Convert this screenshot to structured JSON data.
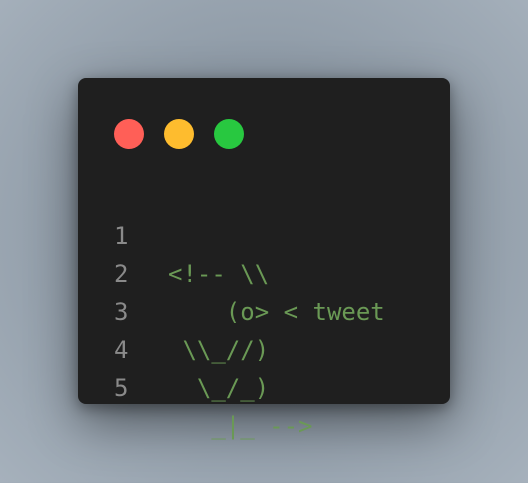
{
  "colors": {
    "red": "#ff5f57",
    "yellow": "#febc2e",
    "green": "#28c840",
    "line_number": "#8a8a8a",
    "code": "#6a9955"
  },
  "lines": [
    {
      "number": "1",
      "text": "<!-- \\\\"
    },
    {
      "number": "2",
      "text": "    (o> < tweet"
    },
    {
      "number": "3",
      "text": " \\\\_//)"
    },
    {
      "number": "4",
      "text": "  \\_/_)"
    },
    {
      "number": "5",
      "text": "   _|_ -->"
    }
  ]
}
